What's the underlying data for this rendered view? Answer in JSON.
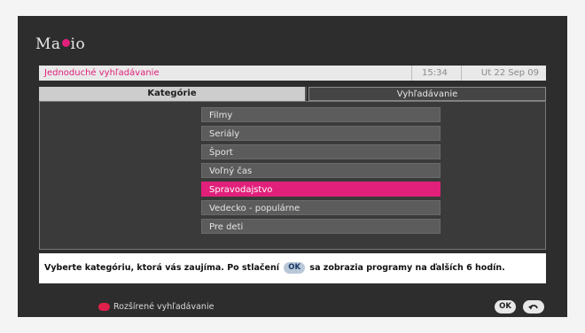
{
  "logo": {
    "prefix": "Ma",
    "suffix": "io"
  },
  "header": {
    "title": "Jednoduché vyhľadávanie",
    "time": "15:34",
    "date": "Ut 22 Sep 09"
  },
  "tabs": [
    {
      "label": "Kategórie"
    },
    {
      "label": "Vyhľadávanie"
    }
  ],
  "categories": [
    {
      "label": "Filmy"
    },
    {
      "label": "Seriály"
    },
    {
      "label": "Šport"
    },
    {
      "label": "Voľný čas"
    },
    {
      "label": "Spravodajstvo",
      "selected": true
    },
    {
      "label": "Vedecko - populárne"
    },
    {
      "label": "Pre deti"
    }
  ],
  "info": {
    "text_before": "Vyberte kategóriu, ktorá vás zaujíma. Po stlačení",
    "ok_label": "OK",
    "text_after": "sa zobrazia programy na ďalších 6 hodín."
  },
  "footer": {
    "advanced_search": "Rozšírené vyhľadávanie",
    "ok_label": "OK"
  },
  "colors": {
    "accent": "#e0207a",
    "red_key": "#e0204a"
  }
}
